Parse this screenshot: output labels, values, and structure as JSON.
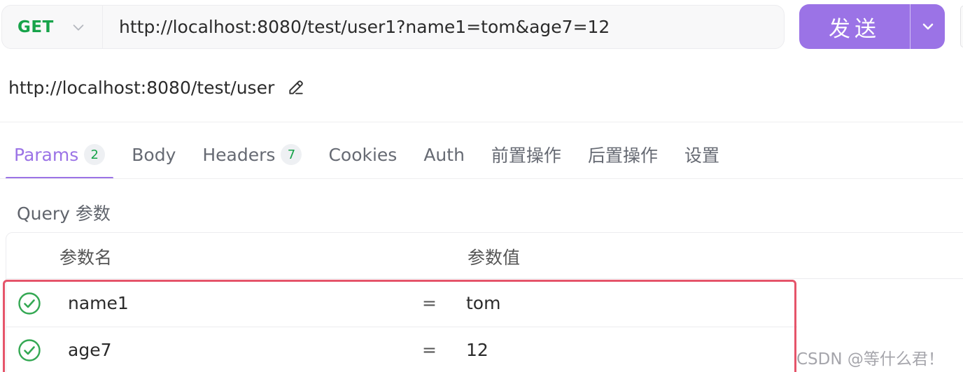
{
  "request": {
    "method": "GET",
    "url": "http://localhost:8080/test/user1?name1=tom&age7=12"
  },
  "send": {
    "label": "发送"
  },
  "endpoint": {
    "path": "http://localhost:8080/test/user"
  },
  "tabs": [
    {
      "label": "Params",
      "badge": "2",
      "active": true
    },
    {
      "label": "Body"
    },
    {
      "label": "Headers",
      "badge": "7"
    },
    {
      "label": "Cookies"
    },
    {
      "label": "Auth"
    },
    {
      "label": "前置操作"
    },
    {
      "label": "后置操作"
    },
    {
      "label": "设置"
    }
  ],
  "query": {
    "section_label": "Query 参数",
    "columns": {
      "name": "参数名",
      "value": "参数值"
    },
    "rows": [
      {
        "name": "name1",
        "eq": "=",
        "value": "tom",
        "enabled": true
      },
      {
        "name": "age7",
        "eq": "=",
        "value": "12",
        "enabled": true
      }
    ]
  },
  "watermark": "CSDN @等什么君！",
  "colors": {
    "accent": "#9b73e6",
    "method_get": "#17a34a",
    "highlight": "#e5546a",
    "check": "#34a853"
  },
  "icons": {
    "method_dropdown": "chevron-down-icon",
    "send_dropdown": "chevron-down-icon",
    "edit": "pencil-icon",
    "row_enabled": "check-circle-icon"
  }
}
